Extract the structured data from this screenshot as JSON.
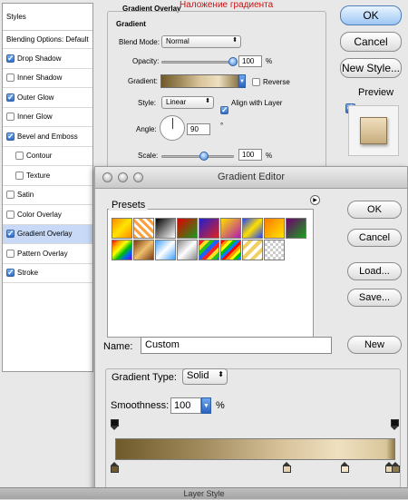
{
  "layer_style": {
    "panel_title": "Styles",
    "blending_options": "Blending Options: Default",
    "styles": [
      {
        "label": "Drop Shadow",
        "checked": true
      },
      {
        "label": "Inner Shadow",
        "checked": false
      },
      {
        "label": "Outer Glow",
        "checked": true
      },
      {
        "label": "Inner Glow",
        "checked": false
      },
      {
        "label": "Bevel and Emboss",
        "checked": true
      },
      {
        "label": "Contour",
        "checked": false
      },
      {
        "label": "Texture",
        "checked": false
      },
      {
        "label": "Satin",
        "checked": false
      },
      {
        "label": "Color Overlay",
        "checked": false
      },
      {
        "label": "Gradient Overlay",
        "checked": true
      },
      {
        "label": "Pattern Overlay",
        "checked": false
      },
      {
        "label": "Stroke",
        "checked": true
      }
    ],
    "overlay_group_title": "Gradient Overlay",
    "overlay_annotation": "Наложение градиента",
    "gradient_subgroup": "Gradient",
    "blend_mode_label": "Blend Mode:",
    "blend_mode_value": "Normal",
    "opacity_label": "Opacity:",
    "opacity_value": "100",
    "opacity_unit": "%",
    "gradient_label": "Gradient:",
    "reverse_label": "Reverse",
    "style_label": "Style:",
    "style_value": "Linear",
    "align_label": "Align with Layer",
    "angle_label": "Angle:",
    "angle_value": "90",
    "angle_unit": "°",
    "scale_label": "Scale:",
    "scale_value": "100",
    "scale_unit": "%",
    "ok_label": "OK",
    "cancel_label": "Cancel",
    "new_style_label": "New Style...",
    "preview_label": "Preview",
    "footer_title": "Layer Style"
  },
  "gradient_editor": {
    "title": "Gradient Editor",
    "presets_label": "Presets",
    "ok_label": "OK",
    "cancel_label": "Cancel",
    "load_label": "Load...",
    "save_label": "Save...",
    "name_label": "Name:",
    "name_value": "Custom",
    "new_label": "New",
    "gradient_type_label": "Gradient Type:",
    "gradient_type_value": "Solid",
    "smoothness_label": "Smoothness:",
    "smoothness_value": "100",
    "smoothness_unit": "%"
  },
  "colors": {
    "accent": "#3d7fd8",
    "annotation": "#cc1111",
    "selection": "#c7d9f6"
  }
}
